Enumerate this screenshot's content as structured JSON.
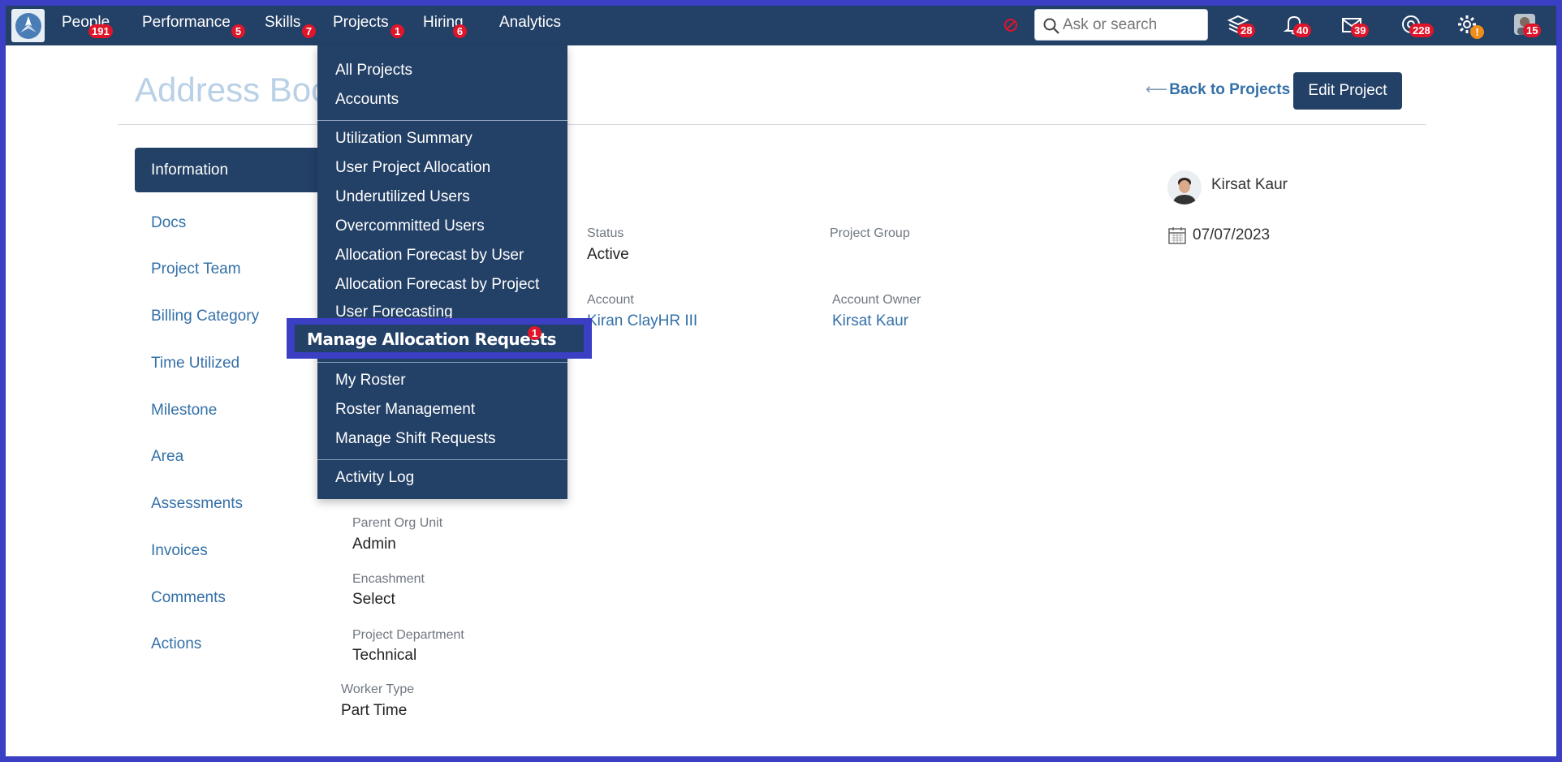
{
  "nav": {
    "items": [
      {
        "label": "People",
        "badge": "191"
      },
      {
        "label": "Performance",
        "badge": "5"
      },
      {
        "label": "Skills",
        "badge": "7"
      },
      {
        "label": "Projects",
        "badge": "1"
      },
      {
        "label": "Hiring",
        "badge": "6"
      },
      {
        "label": "Analytics",
        "badge": ""
      }
    ],
    "search_placeholder": "Ask or search",
    "icons": [
      {
        "name": "stack-icon",
        "badge": "28"
      },
      {
        "name": "bell-icon",
        "badge": "40"
      },
      {
        "name": "mail-icon",
        "badge": "39"
      },
      {
        "name": "support-icon",
        "badge": "228"
      },
      {
        "name": "gear-icon",
        "badge": "!"
      },
      {
        "name": "avatar",
        "badge": "15"
      }
    ]
  },
  "page": {
    "title": "Address Book",
    "back_link": "Back to Projects",
    "edit_button": "Edit Project"
  },
  "sidebar": {
    "items": [
      "Information",
      "Docs",
      "Project Team",
      "Billing Category",
      "Time Utilized",
      "Milestone",
      "Area",
      "Assessments",
      "Invoices",
      "Comments",
      "Actions"
    ]
  },
  "fields": {
    "status": {
      "label": "Status",
      "value": "Active"
    },
    "project_group": {
      "label": "Project Group",
      "value": ""
    },
    "account": {
      "label": "Account",
      "value": "Kiran ClayHR III"
    },
    "account_owner": {
      "label": "Account Owner",
      "value": "Kirsat Kaur"
    },
    "parent_org_unit": {
      "label": "Parent Org Unit",
      "value": "Admin"
    },
    "encashment": {
      "label": "Encashment",
      "value": "Select"
    },
    "project_department": {
      "label": "Project Department",
      "value": "Technical"
    },
    "worker_type": {
      "label": "Worker Type",
      "value": "Part Time"
    }
  },
  "owner": {
    "name": "Kirsat Kaur",
    "date": "07/07/2023"
  },
  "dropdown": {
    "group1": [
      "All Projects",
      "Accounts"
    ],
    "group2": [
      "Utilization Summary",
      "User Project Allocation",
      "Underutilized Users",
      "Overcommitted Users",
      "Allocation Forecast by User",
      "Allocation Forecast by Project",
      "User Forecasting"
    ],
    "highlighted": {
      "label": "Manage Allocation Requests",
      "badge": "1"
    },
    "group3": [
      "My Roster",
      "Roster Management",
      "Manage Shift Requests"
    ],
    "group4": [
      "Activity Log"
    ]
  },
  "colors": {
    "nav_bg": "#234066",
    "badge": "#e0152a",
    "link": "#3470a8",
    "frame": "#3a3fc4"
  }
}
